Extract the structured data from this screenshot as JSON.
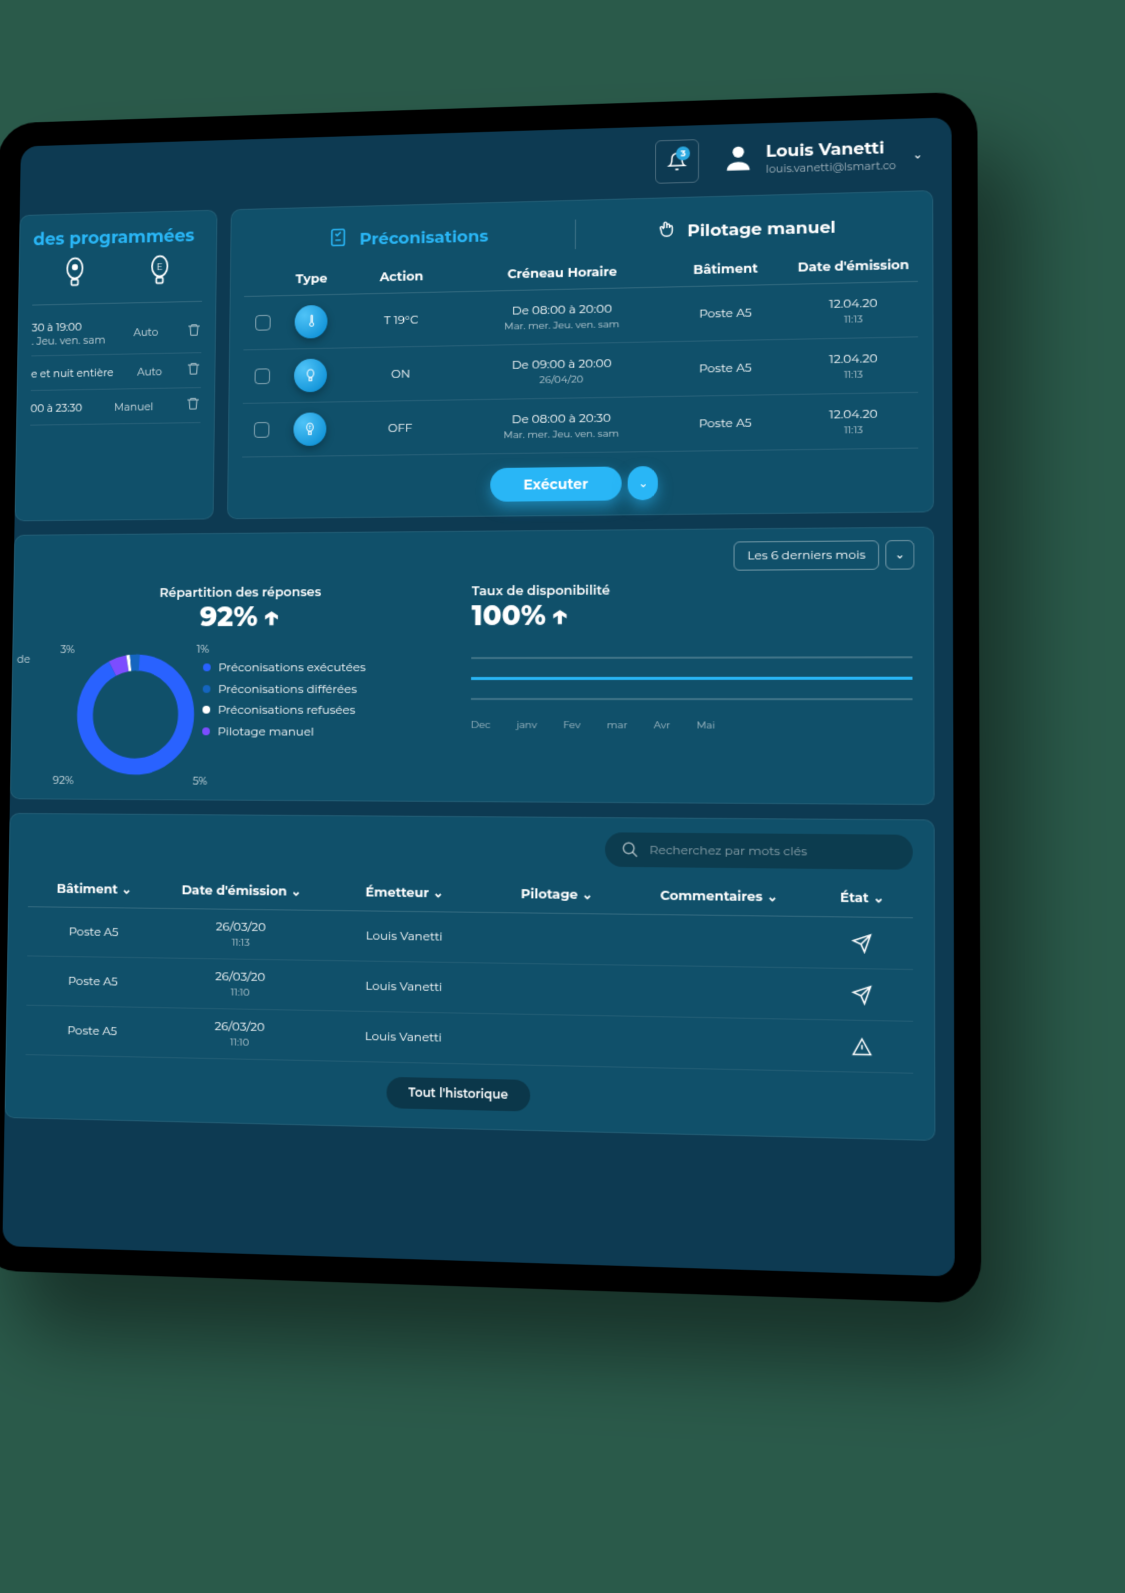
{
  "header": {
    "notification_count": "3",
    "user_name": "Louis Vanetti",
    "user_email": "louis.vanetti@lsmart.co"
  },
  "left_card": {
    "title": "des programmées",
    "rows": [
      {
        "line1": "30 à 19:00",
        "line2": ". Jeu. ven. sam",
        "mode": "Auto"
      },
      {
        "line1": "e et nuit entière",
        "line2": "",
        "mode": "Auto"
      },
      {
        "line1": "00 à 23:30",
        "line2": "",
        "mode": "Manuel"
      }
    ]
  },
  "preco": {
    "tab_active": "Préconisations",
    "tab_inactive": "Pilotage manuel",
    "headers": {
      "type": "Type",
      "action": "Action",
      "creneau": "Créneau Horaire",
      "batiment": "Bâtiment",
      "date": "Date d'émission"
    },
    "rows": [
      {
        "type": "thermo",
        "action": "T 19°C",
        "creneau_l1": "De 08:00 à 20:00",
        "creneau_l2": "Mar. mer. Jeu. ven. sam",
        "bat": "Poste A5",
        "date_l1": "12.04.20",
        "date_l2": "11:13"
      },
      {
        "type": "light",
        "action": "ON",
        "creneau_l1": "De 09:00 à 20:00",
        "creneau_l2": "26/04/20",
        "bat": "Poste A5",
        "date_l1": "12.04.20",
        "date_l2": "11:13"
      },
      {
        "type": "plug",
        "action": "OFF",
        "creneau_l1": "De 08:00 à 20:30",
        "creneau_l2": "Mar. mer. Jeu. ven. sam",
        "bat": "Poste A5",
        "date_l1": "12.04.20",
        "date_l2": "11:13"
      }
    ],
    "exec_label": "Exécuter"
  },
  "stats": {
    "period_label": "Les 6 derniers mois",
    "repartition_title": "Répartition des réponses",
    "repartition_value": "92%",
    "avail_title": "Taux de disponibilité",
    "avail_value": "100%",
    "truncated_left": "de",
    "legend": {
      "executees": "Préconisations exécutées",
      "differees": "Préconisations différées",
      "refusees": "Préconisations refusées",
      "manuel": "Pilotage manuel"
    },
    "donut_labels": {
      "top_left": "3%",
      "top_right": "1%",
      "bot_left": "92%",
      "bot_right": "5%"
    },
    "months": [
      "Dec",
      "janv",
      "Fev",
      "mar",
      "Avr",
      "Mai"
    ]
  },
  "history": {
    "search_placeholder": "Recherchez par mots clés",
    "headers": {
      "bat": "Bâtiment",
      "date": "Date d'émission",
      "emetteur": "Émetteur",
      "pilotage": "Pilotage",
      "comment": "Commentaires",
      "etat": "État"
    },
    "rows": [
      {
        "bat": "Poste A5",
        "date_l1": "26/03/20",
        "date_l2": "11:13",
        "emetteur": "Louis Vanetti",
        "pilot_color": "#29b6f6",
        "icon": "send"
      },
      {
        "bat": "Poste A5",
        "date_l1": "26/03/20",
        "date_l2": "11:10",
        "emetteur": "Louis Vanetti",
        "pilot_color": "#4a6bff",
        "icon": "send"
      },
      {
        "bat": "Poste A5",
        "date_l1": "26/03/20",
        "date_l2": "11:10",
        "emetteur": "Louis Vanetti",
        "pilot_color": "#ffffff",
        "icon": "warn"
      }
    ],
    "all_btn": "Tout l'historique"
  },
  "chart_data": {
    "type": "pie",
    "title": "Répartition des réponses",
    "series": [
      {
        "name": "Préconisations exécutées",
        "value": 92,
        "color": "#2962ff"
      },
      {
        "name": "Préconisations différées",
        "value": 3,
        "color": "#1565c0"
      },
      {
        "name": "Préconisations refusées",
        "value": 1,
        "color": "#ffffff"
      },
      {
        "name": "Pilotage manuel",
        "value": 5,
        "color": "#7c4dff"
      }
    ]
  }
}
